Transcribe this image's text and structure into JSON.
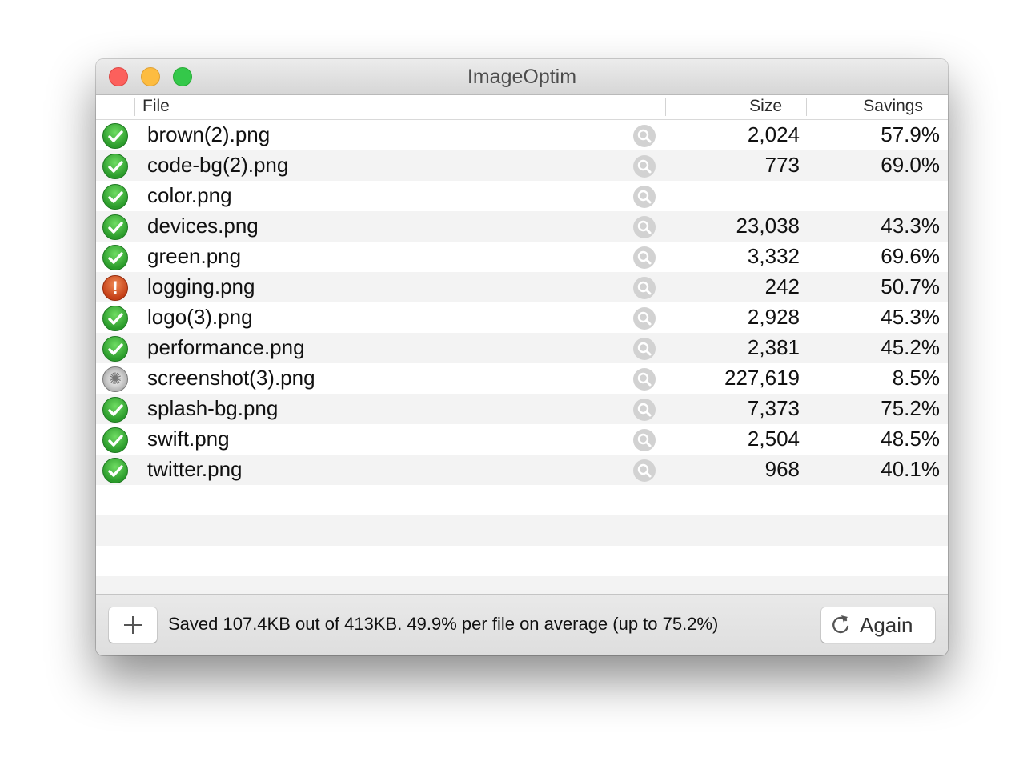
{
  "window": {
    "title": "ImageOptim"
  },
  "columns": {
    "file": "File",
    "size": "Size",
    "savings": "Savings"
  },
  "files": [
    {
      "name": "brown(2).png",
      "status": "ok",
      "size": "2,024",
      "savings": "57.9%"
    },
    {
      "name": "code-bg(2).png",
      "status": "ok",
      "size": "773",
      "savings": "69.0%"
    },
    {
      "name": "color.png",
      "status": "ok",
      "size": "",
      "savings": ""
    },
    {
      "name": "devices.png",
      "status": "ok",
      "size": "23,038",
      "savings": "43.3%"
    },
    {
      "name": "green.png",
      "status": "ok",
      "size": "3,332",
      "savings": "69.6%"
    },
    {
      "name": "logging.png",
      "status": "error",
      "size": "242",
      "savings": "50.7%"
    },
    {
      "name": "logo(3).png",
      "status": "ok",
      "size": "2,928",
      "savings": "45.3%"
    },
    {
      "name": "performance.png",
      "status": "ok",
      "size": "2,381",
      "savings": "45.2%"
    },
    {
      "name": "screenshot(3).png",
      "status": "busy",
      "size": "227,619",
      "savings": "8.5%"
    },
    {
      "name": "splash-bg.png",
      "status": "ok",
      "size": "7,373",
      "savings": "75.2%"
    },
    {
      "name": "swift.png",
      "status": "ok",
      "size": "2,504",
      "savings": "48.5%"
    },
    {
      "name": "twitter.png",
      "status": "ok",
      "size": "968",
      "savings": "40.1%"
    }
  ],
  "footer": {
    "add_icon": "plus-icon",
    "status_text": "Saved 107.4KB out of 413KB. 49.9% per file on average (up to 75.2%)",
    "again_label": "Again",
    "again_icon": "refresh-icon"
  },
  "colors": {
    "ok": "#2b9b2b",
    "error": "#c43f17",
    "close": "#fc605c",
    "minimize": "#fdbc40",
    "zoom": "#34c84a"
  }
}
